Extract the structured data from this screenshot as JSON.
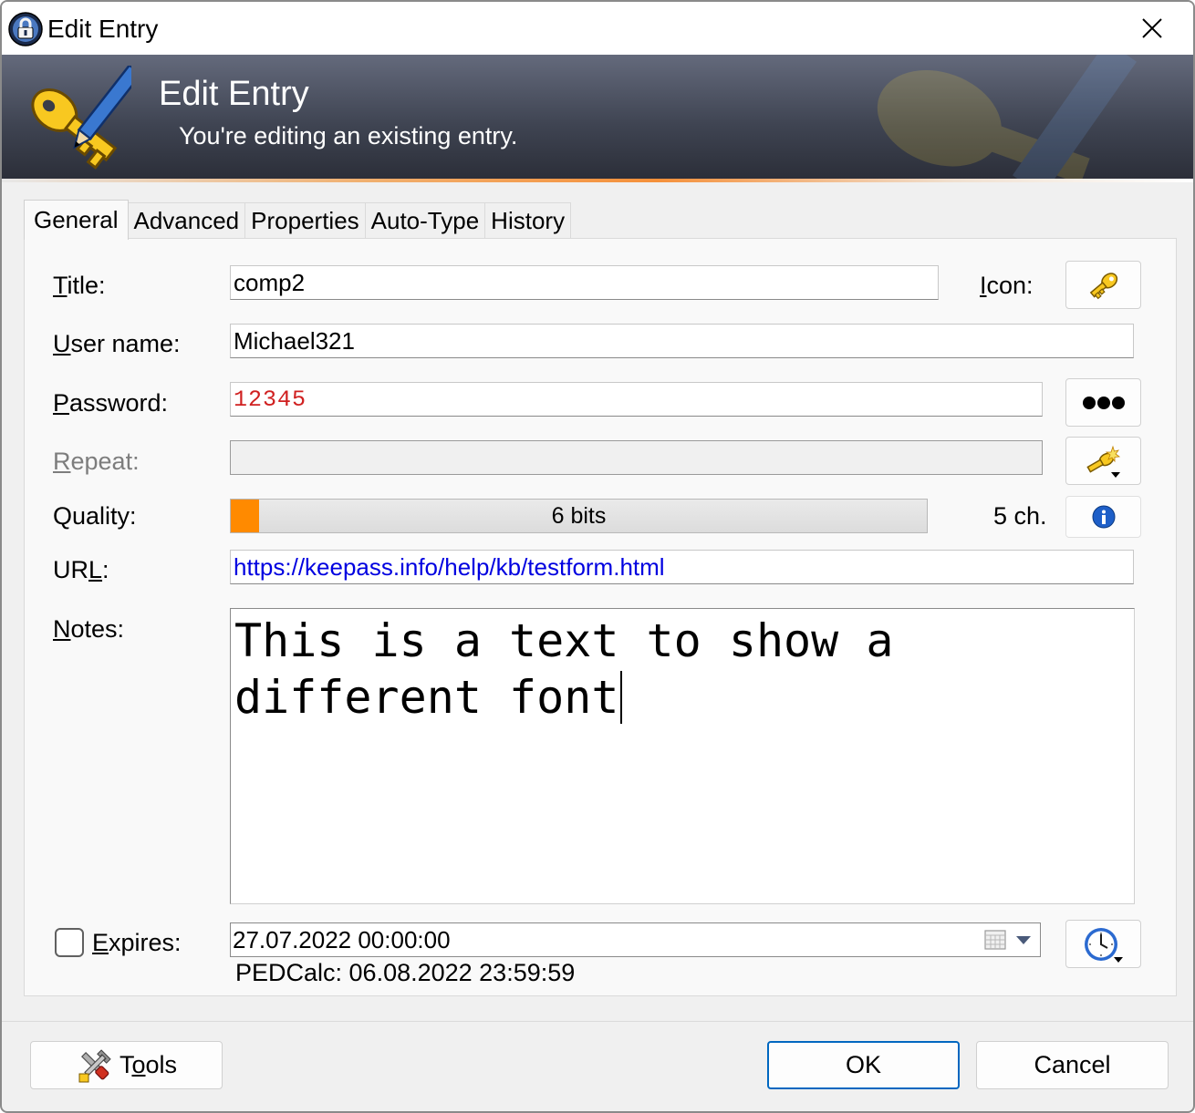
{
  "window": {
    "title": "Edit Entry"
  },
  "banner": {
    "title": "Edit Entry",
    "subtitle": "You're editing an existing entry."
  },
  "tabs": [
    {
      "label": "General",
      "active": true
    },
    {
      "label": "Advanced",
      "active": false
    },
    {
      "label": "Properties",
      "active": false
    },
    {
      "label": "Auto-Type",
      "active": false
    },
    {
      "label": "History",
      "active": false
    }
  ],
  "form": {
    "title_label_key": "T",
    "title_label_rest": "itle:",
    "title_value": "comp2",
    "icon_label_key": "I",
    "icon_label_rest": "con:",
    "username_label_key": "U",
    "username_label_rest": "ser name:",
    "username_value": "Michael321",
    "password_label_key": "P",
    "password_label_rest": "assword:",
    "password_value": "12345",
    "repeat_label_key": "R",
    "repeat_label_rest": "epeat:",
    "repeat_value": "",
    "quality_label": "Quality:",
    "quality_text": "6 bits",
    "quality_fraction": 0.04,
    "char_count": "5 ch.",
    "url_label_pre": "UR",
    "url_label_key": "L",
    "url_label_rest": ":",
    "url_value": "https://keepass.info/help/kb/testform.html",
    "notes_label_key": "N",
    "notes_label_rest": "otes:",
    "notes_value": "This is a text to show a different font",
    "expires_label_key": "E",
    "expires_label_rest": "xpires:",
    "expires_checked": false,
    "expires_value": "27.07.2022 00:00:00",
    "pedcalc_text": "PEDCalc: 06.08.2022 23:59:59"
  },
  "footer": {
    "tools_pre": "T",
    "tools_key": "o",
    "tools_rest": "ols",
    "ok_label": "OK",
    "cancel_label": "Cancel"
  },
  "colors": {
    "accent": "#0067c0",
    "quality_fill": "#ff8a00",
    "password_text": "#d02020",
    "url_text": "#0000e0"
  },
  "icons": [
    "keepass-lock-icon",
    "close-icon",
    "key-edit-icon",
    "key-icon",
    "show-password-icon",
    "password-generator-icon",
    "info-icon",
    "calendar-icon",
    "dropdown-arrow-icon",
    "clock-icon",
    "tools-icon"
  ]
}
